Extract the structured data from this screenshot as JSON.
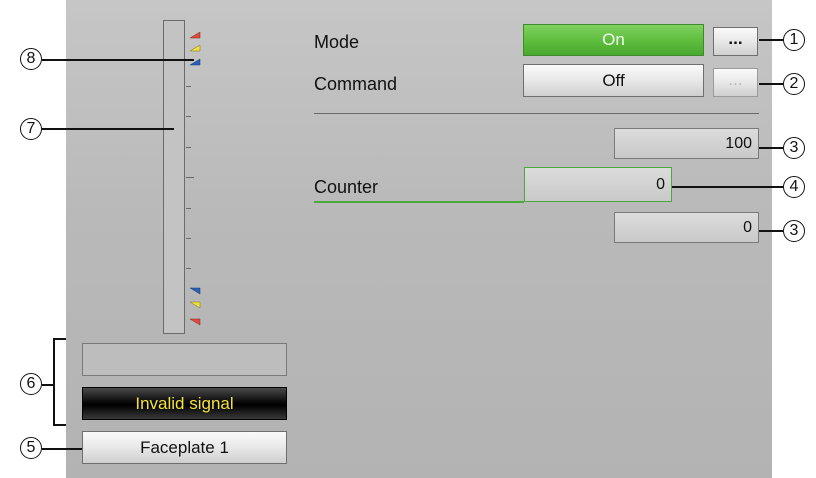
{
  "mode": {
    "label": "Mode",
    "value": "On",
    "more": "..."
  },
  "command": {
    "label": "Command",
    "value": "Off",
    "more": "..."
  },
  "counter": {
    "label": "Counter",
    "upper_value": "100",
    "current_value": "0",
    "lower_value": "0"
  },
  "status": {
    "blank_field": "",
    "signal_text": "Invalid signal"
  },
  "faceplate_button": "Faceplate 1",
  "callouts": [
    "1",
    "2",
    "3",
    "4",
    "3",
    "5",
    "6",
    "7",
    "8"
  ],
  "colors": {
    "mode_on": "#5cbc3c",
    "counter_border": "#4aa83c",
    "invalid_text": "#f5e23a",
    "limit_red": "#e04a3c",
    "limit_yellow": "#f0e040",
    "limit_blue": "#2b5fb8"
  }
}
